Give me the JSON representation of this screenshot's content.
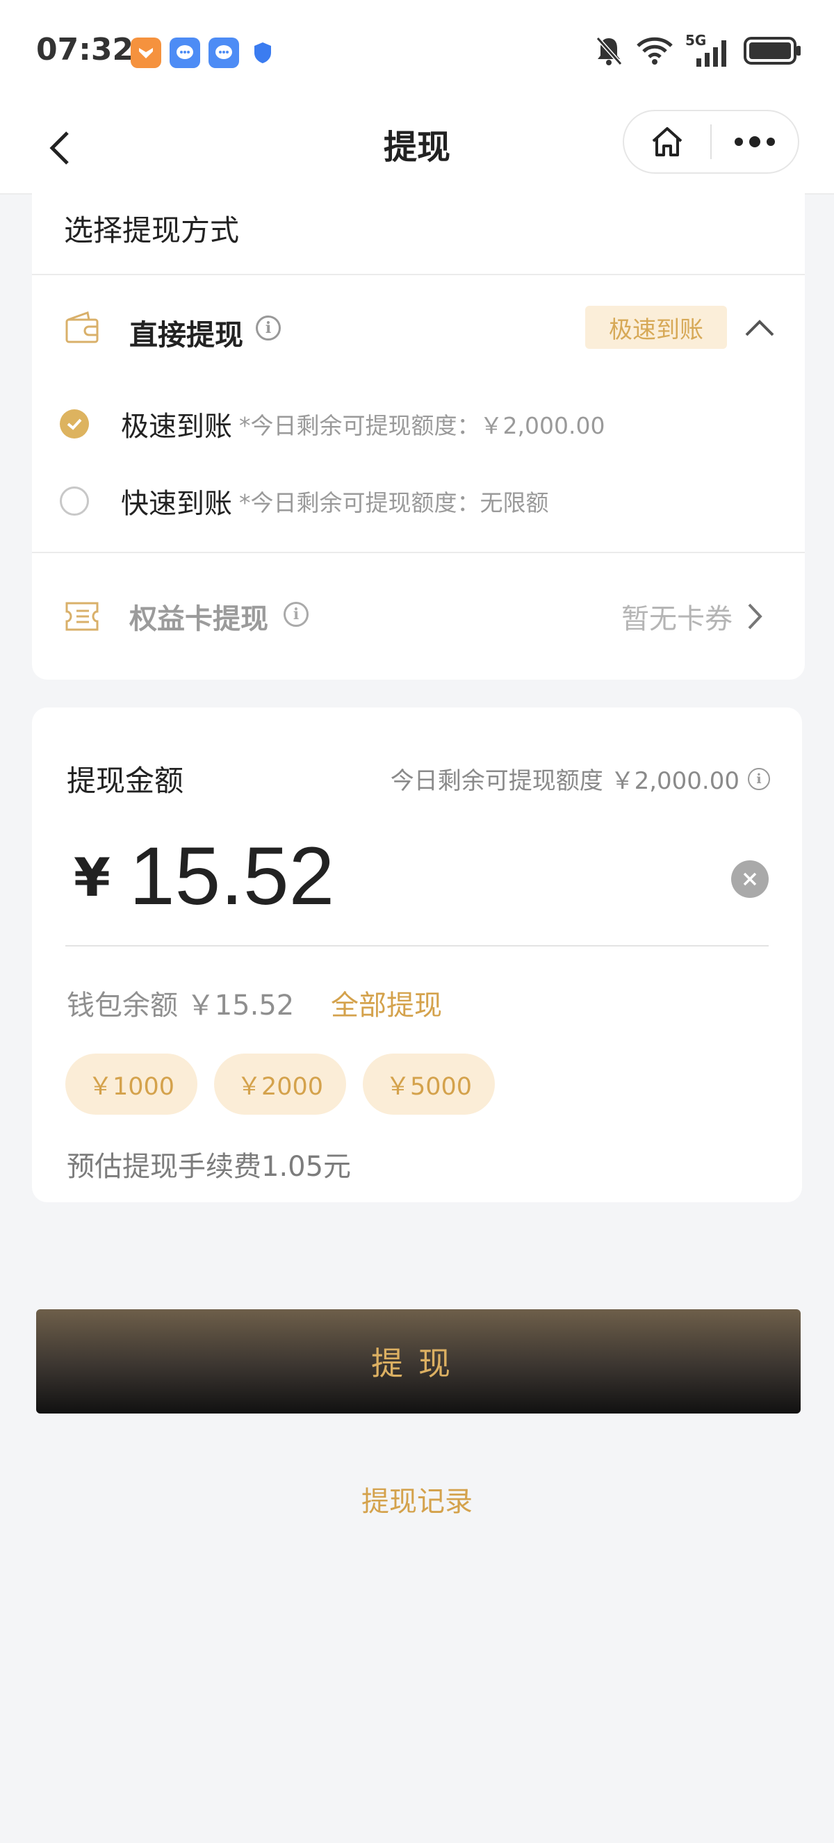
{
  "status_bar": {
    "time": "07:32",
    "network": "5G"
  },
  "nav": {
    "title": "提现"
  },
  "method_section": {
    "heading": "选择提现方式",
    "direct": {
      "title": "直接提现",
      "badge": "极速到账"
    },
    "options": [
      {
        "label": "极速到账",
        "note": "*今日剩余可提现额度：￥2,000.00",
        "selected": true
      },
      {
        "label": "快速到账",
        "note": "*今日剩余可提现额度：无限额",
        "selected": false
      }
    ],
    "card_withdraw": {
      "title": "权益卡提现",
      "status": "暂无卡券"
    }
  },
  "amount_section": {
    "title": "提现金额",
    "limit": "今日剩余可提现额度 ￥2,000.00",
    "currency": "¥",
    "amount": "15.52",
    "balance": "钱包余额 ￥15.52",
    "withdraw_all": "全部提现",
    "quick_amounts": [
      "￥1000",
      "￥2000",
      "￥5000"
    ],
    "fee": "预估提现手续费1.05元"
  },
  "submit_label": "提现",
  "records_link": "提现记录",
  "colors": {
    "accent": "#d4a24c",
    "badge_bg": "#fbeed9",
    "page_bg": "#f4f5f7"
  },
  "icons": [
    "back-arrow-icon",
    "home-icon",
    "more-dots-icon",
    "wallet-icon",
    "info-icon",
    "chevron-up-icon",
    "check-icon",
    "ticket-card-icon",
    "chevron-right-icon",
    "clear-icon",
    "bell-off-icon",
    "wifi-icon",
    "signal-icon",
    "battery-icon"
  ]
}
